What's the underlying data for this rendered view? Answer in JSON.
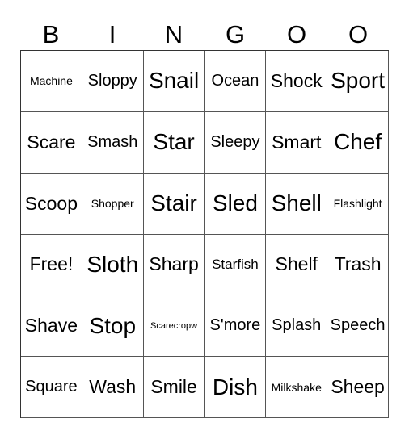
{
  "header": [
    "B",
    "I",
    "N",
    "G",
    "O",
    "O"
  ],
  "cells": [
    [
      "Machine",
      "Sloppy",
      "Snail",
      "Ocean",
      "Shock",
      "Sport"
    ],
    [
      "Scare",
      "Smash",
      "Star",
      "Sleepy",
      "Smart",
      "Chef"
    ],
    [
      "Scoop",
      "Shopper",
      "Stair",
      "Sled",
      "Shell",
      "Flashlight"
    ],
    [
      "Free!",
      "Sloth",
      "Sharp",
      "Starfish",
      "Shelf",
      "Trash"
    ],
    [
      "Shave",
      "Stop",
      "Scarecropw",
      "S'more",
      "Splash",
      "Speech"
    ],
    [
      "Square",
      "Wash",
      "Smile",
      "Dish",
      "Milkshake",
      "Sheep"
    ]
  ]
}
